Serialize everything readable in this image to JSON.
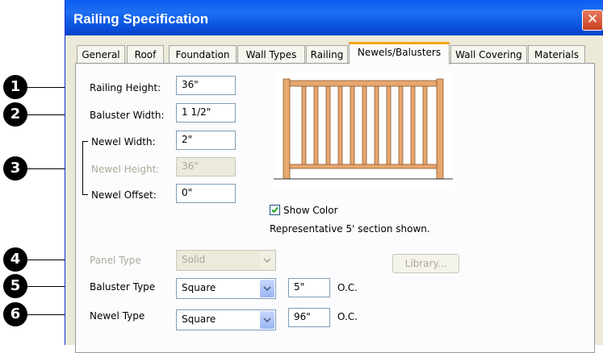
{
  "window": {
    "title": "Railing Specification",
    "close_glyph": "✕"
  },
  "tabs": [
    {
      "label": "General"
    },
    {
      "label": "Roof"
    },
    {
      "label": "Foundation"
    },
    {
      "label": "Wall Types"
    },
    {
      "label": "Railing"
    },
    {
      "label": "Newels/Balusters",
      "active": true
    },
    {
      "label": "Wall Covering"
    },
    {
      "label": "Materials"
    }
  ],
  "form": {
    "railing_height": {
      "label": "Railing Height:",
      "value": "36\""
    },
    "baluster_width": {
      "label": "Baluster Width:",
      "value": "1 1/2\""
    },
    "newel_width": {
      "label": "Newel Width:",
      "value": "2\""
    },
    "newel_height": {
      "label": "Newel Height:",
      "value": "36\"",
      "disabled": true
    },
    "newel_offset": {
      "label": "Newel Offset:",
      "value": "0\""
    },
    "show_color": {
      "label": "Show Color",
      "checked": true
    },
    "preview_note": "Representative 5' section shown.",
    "panel_type": {
      "label": "Panel Type",
      "value": "Solid",
      "disabled": true
    },
    "library_button": "Library...",
    "baluster_type": {
      "label": "Baluster Type",
      "value": "Square",
      "spacing": "5\"",
      "oc": "O.C."
    },
    "newel_type": {
      "label": "Newel Type",
      "value": "Square",
      "spacing": "96\"",
      "oc": "O.C."
    }
  },
  "callouts": [
    "1",
    "2",
    "3",
    "4",
    "5",
    "6"
  ],
  "colors": {
    "title_bar": "#0a5ef0",
    "active_tab_accent": "#f6a51a",
    "rail_wood": "#e8a76e",
    "checkmark": "#21a121"
  }
}
